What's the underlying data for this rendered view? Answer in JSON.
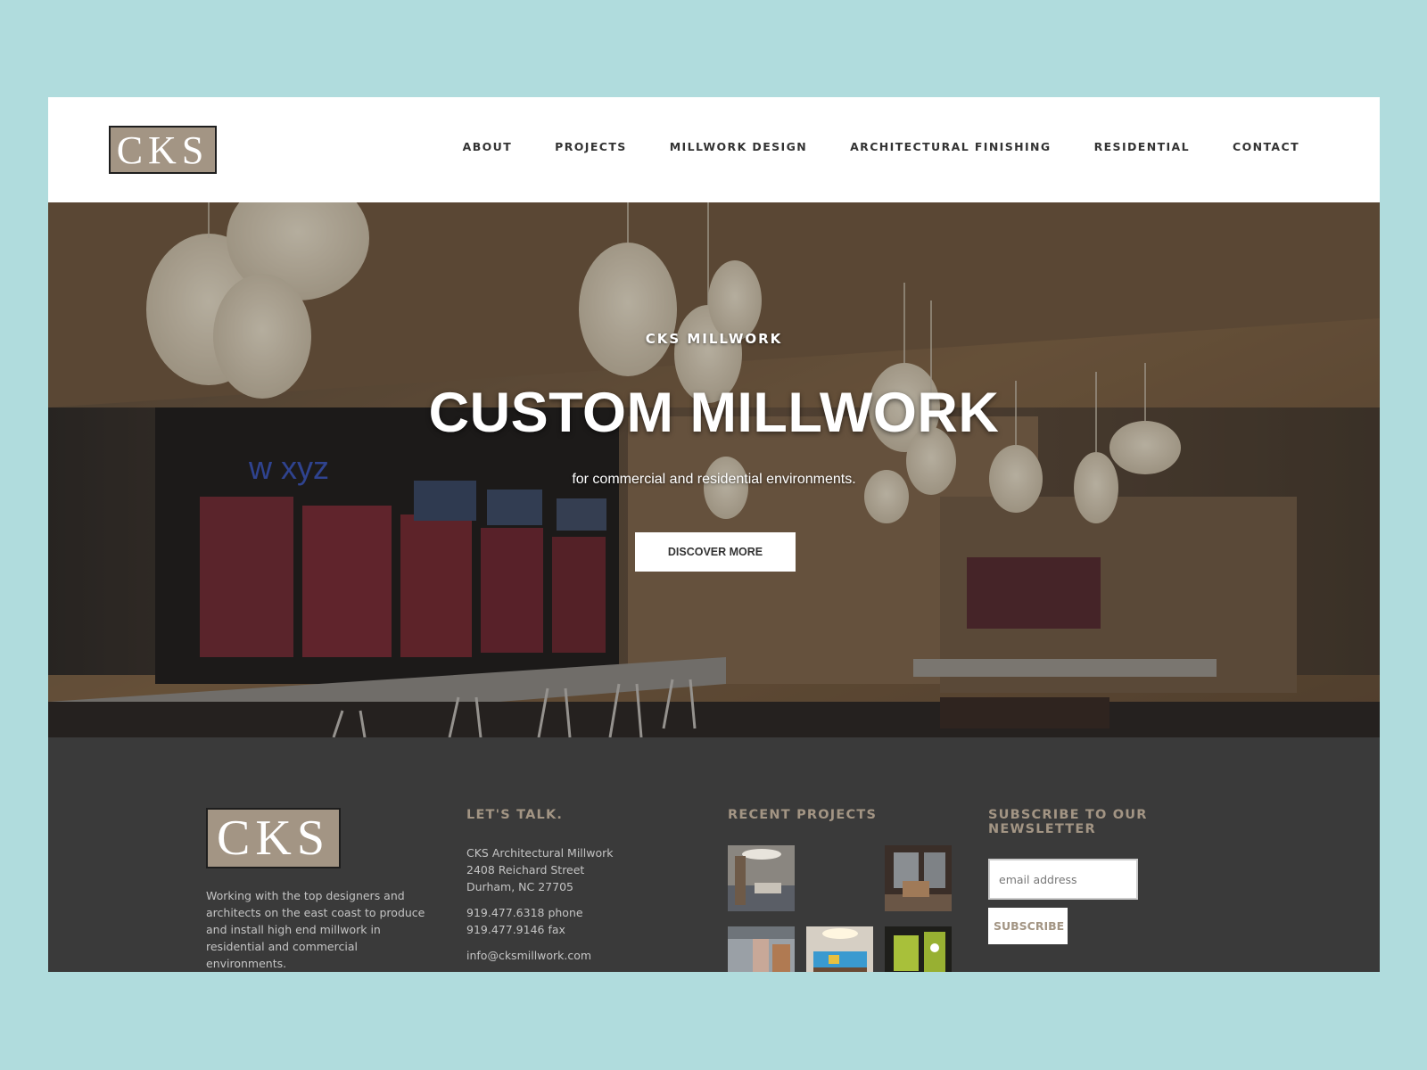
{
  "header": {
    "logo_text": "CKS",
    "nav": [
      "ABOUT",
      "PROJECTS",
      "MILLWORK DESIGN",
      "ARCHITECTURAL FINISHING",
      "RESIDENTIAL",
      "CONTACT"
    ]
  },
  "hero": {
    "kicker": "CKS MILLWORK",
    "title": "CUSTOM MILLWORK",
    "subtitle": "for commercial and residential environments.",
    "button_label": "DISCOVER MORE",
    "sign_text": "w xyz"
  },
  "footer": {
    "logo_text": "CKS",
    "about_text": "Working with the top designers and architects on the east coast to produce and install high end millwork in residential and commercial environments.",
    "talk_heading": "LET'S TALK.",
    "address_lines": [
      "CKS Architectural Millwork",
      "2408 Reichard Street",
      "Durham, NC 27705"
    ],
    "phone": "919.477.6318 phone",
    "fax": "919.477.9146 fax",
    "email": "info@cksmillwork.com",
    "projects_heading": "RECENT PROJECTS",
    "newsletter_heading_line1": "SUBSCRIBE TO OUR",
    "newsletter_heading_line2": "NEWSLETTER",
    "email_placeholder": "email address",
    "subscribe_label": "SUBSCRIBE"
  },
  "colors": {
    "page_background": "#b0dcdd",
    "brand_taupe": "#a39584",
    "footer_background": "#3a3a3a"
  }
}
